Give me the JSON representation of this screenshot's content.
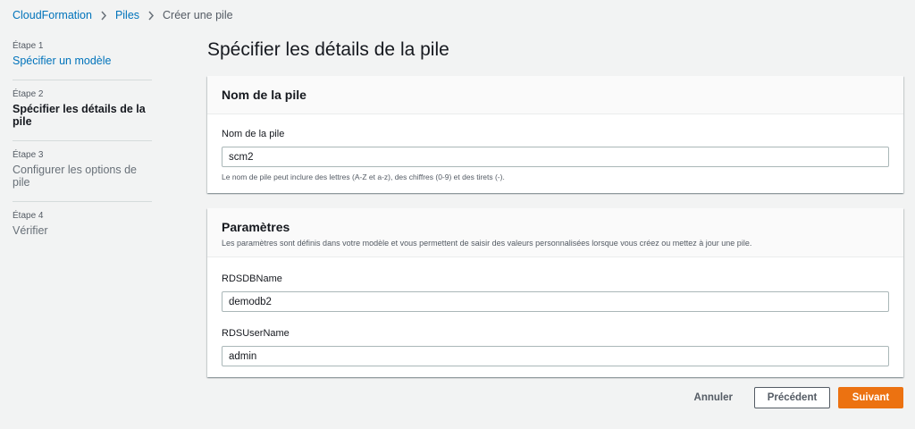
{
  "breadcrumb": {
    "items": [
      "CloudFormation",
      "Piles"
    ],
    "current": "Créer une pile"
  },
  "steps": [
    {
      "num": "Étape 1",
      "label": "Spécifier un modèle"
    },
    {
      "num": "Étape 2",
      "label": "Spécifier les détails de la pile"
    },
    {
      "num": "Étape 3",
      "label": "Configurer les options de pile"
    },
    {
      "num": "Étape 4",
      "label": "Vérifier"
    }
  ],
  "page": {
    "title": "Spécifier les détails de la pile"
  },
  "stack_panel": {
    "title": "Nom de la pile",
    "field_label": "Nom de la pile",
    "field_value": "scm2",
    "hint": "Le nom de pile peut inclure des lettres (A-Z et a-z), des chiffres (0-9) et des tirets (-)."
  },
  "params_panel": {
    "title": "Paramètres",
    "desc": "Les paramètres sont définis dans votre modèle et vous permettent de saisir des valeurs personnalisées lorsque vous créez ou mettez à jour une pile.",
    "fields": [
      {
        "label": "RDSDBName",
        "value": "demodb2"
      },
      {
        "label": "RDSUserName",
        "value": "admin"
      }
    ]
  },
  "actions": {
    "cancel": "Annuler",
    "previous": "Précédent",
    "next": "Suivant"
  },
  "colors": {
    "link": "#0073bb",
    "primary": "#ec7211",
    "background": "#f2f3f3"
  }
}
